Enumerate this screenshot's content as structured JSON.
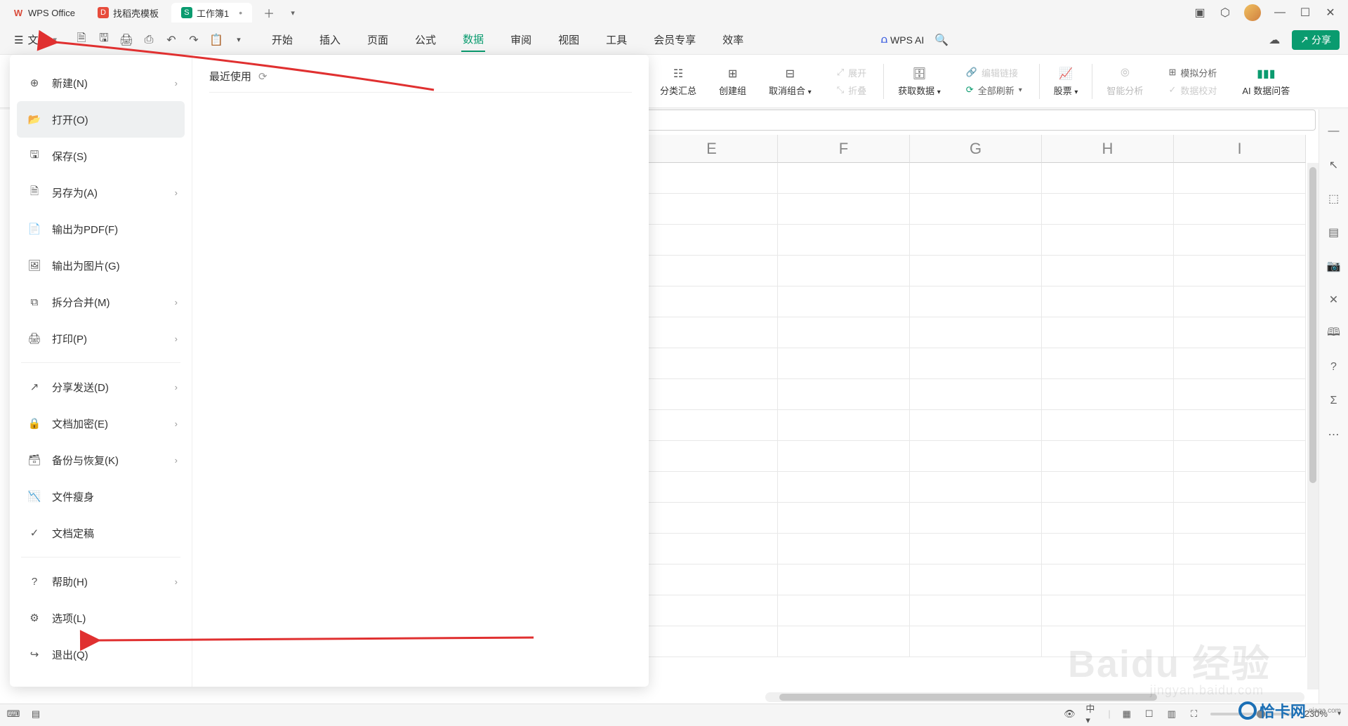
{
  "titlebar": {
    "app_name": "WPS Office",
    "tabs": [
      {
        "label": "找稻壳模板"
      },
      {
        "label": "工作簿1"
      }
    ]
  },
  "menubar": {
    "file_label": "文件",
    "tabs": [
      "开始",
      "插入",
      "页面",
      "公式",
      "数据",
      "审阅",
      "视图",
      "工具",
      "会员专享",
      "效率"
    ],
    "active_tab": "数据",
    "wpsai": "WPS AI",
    "share": "分享"
  },
  "ribbon": {
    "items": [
      {
        "label": "分类汇总"
      },
      {
        "label": "创建组"
      },
      {
        "label": "取消组合"
      },
      {
        "label": "展开",
        "disabled": true
      },
      {
        "label": "折叠",
        "disabled": true
      },
      {
        "label": "获取数据"
      },
      {
        "label": "全部刷新"
      },
      {
        "label": "编辑链接",
        "disabled": true
      },
      {
        "label": "股票"
      },
      {
        "label": "智能分析",
        "disabled": true
      },
      {
        "label": "模拟分析"
      },
      {
        "label": "数据校对",
        "disabled": true
      },
      {
        "label": "AI 数据问答"
      }
    ]
  },
  "file_menu": {
    "recent_title": "最近使用",
    "items": [
      {
        "label": "新建(N)",
        "arrow": true
      },
      {
        "label": "打开(O)",
        "active": true
      },
      {
        "label": "保存(S)"
      },
      {
        "label": "另存为(A)",
        "arrow": true
      },
      {
        "label": "输出为PDF(F)"
      },
      {
        "label": "输出为图片(G)"
      },
      {
        "label": "拆分合并(M)",
        "arrow": true
      },
      {
        "label": "打印(P)",
        "arrow": true
      },
      {
        "divider": true
      },
      {
        "label": "分享发送(D)",
        "arrow": true
      },
      {
        "label": "文档加密(E)",
        "arrow": true
      },
      {
        "label": "备份与恢复(K)",
        "arrow": true
      },
      {
        "label": "文件瘦身"
      },
      {
        "label": "文档定稿"
      },
      {
        "divider": true
      },
      {
        "label": "帮助(H)",
        "arrow": true
      },
      {
        "label": "选项(L)"
      },
      {
        "label": "退出(Q)"
      }
    ]
  },
  "sheet": {
    "columns": [
      "E",
      "F",
      "G",
      "H",
      "I"
    ]
  },
  "statusbar": {
    "zoom": "230%"
  },
  "watermark": {
    "main": "Baidu 经验",
    "sub": "jingyan.baidu.com"
  },
  "qiaka": {
    "name": "恰卡网",
    "sub": "qiaqa.com"
  }
}
